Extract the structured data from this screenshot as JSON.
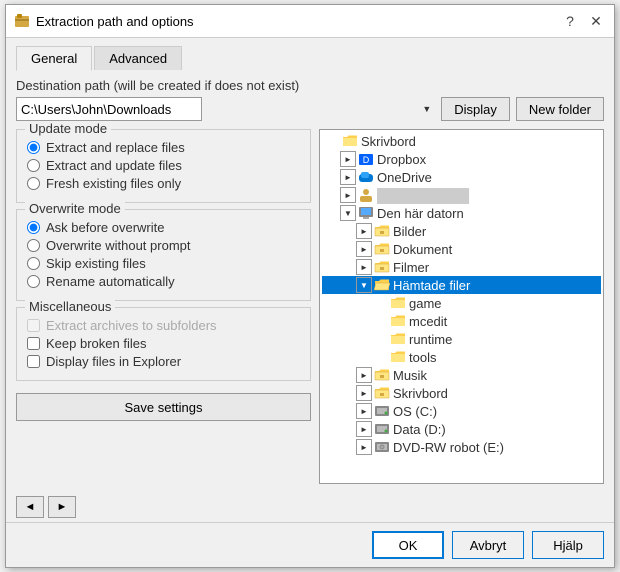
{
  "titleBar": {
    "icon": "📦",
    "title": "Extraction path and options",
    "helpBtn": "?",
    "closeBtn": "✕"
  },
  "tabs": [
    {
      "id": "general",
      "label": "General",
      "active": true
    },
    {
      "id": "advanced",
      "label": "Advanced",
      "active": false
    }
  ],
  "destPath": {
    "label": "Destination path (will be created if does not exist)",
    "value": "C:\\Users\\John\\Downloads",
    "displayBtn": "Display",
    "newFolderBtn": "New folder"
  },
  "updateMode": {
    "title": "Update mode",
    "options": [
      {
        "id": "extract-replace",
        "label": "Extract and replace files",
        "checked": true
      },
      {
        "id": "extract-update",
        "label": "Extract and update files",
        "checked": false
      },
      {
        "id": "fresh-existing",
        "label": "Fresh existing files only",
        "checked": false
      }
    ]
  },
  "overwriteMode": {
    "title": "Overwrite mode",
    "options": [
      {
        "id": "ask-before",
        "label": "Ask before overwrite",
        "checked": true
      },
      {
        "id": "overwrite-noprompt",
        "label": "Overwrite without prompt",
        "checked": false
      },
      {
        "id": "skip-existing",
        "label": "Skip existing files",
        "checked": false
      },
      {
        "id": "rename-auto",
        "label": "Rename automatically",
        "checked": false
      }
    ]
  },
  "miscellaneous": {
    "title": "Miscellaneous",
    "options": [
      {
        "id": "extract-subfolders",
        "label": "Extract archives to subfolders",
        "checked": false,
        "disabled": true
      },
      {
        "id": "keep-broken",
        "label": "Keep broken files",
        "checked": false,
        "disabled": false
      },
      {
        "id": "display-explorer",
        "label": "Display files in Explorer",
        "checked": false,
        "disabled": false
      }
    ]
  },
  "saveBtn": "Save settings",
  "tree": {
    "items": [
      {
        "id": "skrivbord-top",
        "label": "Skrivbord",
        "indent": 0,
        "expand": false,
        "iconType": "folder-blue",
        "selected": false,
        "hasExpand": false
      },
      {
        "id": "dropbox",
        "label": "Dropbox",
        "indent": 1,
        "expand": false,
        "iconType": "dropbox",
        "selected": false,
        "hasExpand": true
      },
      {
        "id": "onedrive",
        "label": "OneDrive",
        "indent": 1,
        "expand": false,
        "iconType": "onedrive",
        "selected": false,
        "hasExpand": true
      },
      {
        "id": "user-blurred",
        "label": "██████████",
        "indent": 1,
        "expand": false,
        "iconType": "user",
        "selected": false,
        "hasExpand": true
      },
      {
        "id": "den-har-datorn",
        "label": "Den här datorn",
        "indent": 1,
        "expand": true,
        "iconType": "computer",
        "selected": false,
        "hasExpand": true
      },
      {
        "id": "bilder",
        "label": "Bilder",
        "indent": 2,
        "expand": false,
        "iconType": "folder-special",
        "selected": false,
        "hasExpand": true
      },
      {
        "id": "dokument",
        "label": "Dokument",
        "indent": 2,
        "expand": false,
        "iconType": "folder-special",
        "selected": false,
        "hasExpand": true
      },
      {
        "id": "filmer",
        "label": "Filmer",
        "indent": 2,
        "expand": false,
        "iconType": "folder-special",
        "selected": false,
        "hasExpand": true
      },
      {
        "id": "hamtade-filer",
        "label": "Hämtade filer",
        "indent": 2,
        "expand": true,
        "iconType": "folder-open",
        "selected": true,
        "hasExpand": true
      },
      {
        "id": "game",
        "label": "game",
        "indent": 3,
        "expand": false,
        "iconType": "folder-yellow",
        "selected": false,
        "hasExpand": false
      },
      {
        "id": "mcedit",
        "label": "mcedit",
        "indent": 3,
        "expand": false,
        "iconType": "folder-yellow",
        "selected": false,
        "hasExpand": false
      },
      {
        "id": "runtime",
        "label": "runtime",
        "indent": 3,
        "expand": false,
        "iconType": "folder-yellow",
        "selected": false,
        "hasExpand": false
      },
      {
        "id": "tools",
        "label": "tools",
        "indent": 3,
        "expand": false,
        "iconType": "folder-yellow",
        "selected": false,
        "hasExpand": false
      },
      {
        "id": "musik",
        "label": "Musik",
        "indent": 2,
        "expand": false,
        "iconType": "folder-special",
        "selected": false,
        "hasExpand": true
      },
      {
        "id": "skrivbord-local",
        "label": "Skrivbord",
        "indent": 2,
        "expand": false,
        "iconType": "folder-special",
        "selected": false,
        "hasExpand": true
      },
      {
        "id": "os-c",
        "label": "OS (C:)",
        "indent": 2,
        "expand": false,
        "iconType": "drive",
        "selected": false,
        "hasExpand": true
      },
      {
        "id": "data-d",
        "label": "Data (D:)",
        "indent": 2,
        "expand": false,
        "iconType": "drive",
        "selected": false,
        "hasExpand": true
      },
      {
        "id": "dvd-rw",
        "label": "DVD-RW robot (E:)",
        "indent": 2,
        "expand": false,
        "iconType": "drive-dvd",
        "selected": false,
        "hasExpand": true
      }
    ]
  },
  "treeNavigation": {
    "leftArrow": "◄",
    "rightArrow": "►"
  },
  "bottomButtons": {
    "ok": "OK",
    "cancel": "Avbryt",
    "help": "Hjälp"
  }
}
